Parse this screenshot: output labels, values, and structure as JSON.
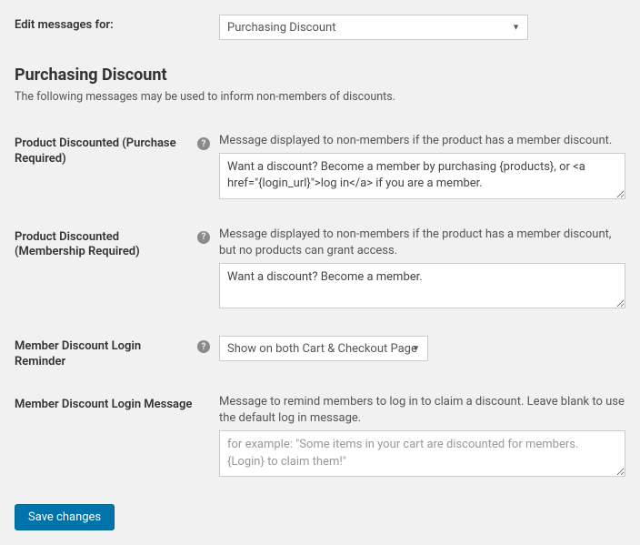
{
  "top": {
    "label": "Edit messages for:",
    "selected": "Purchasing Discount"
  },
  "section": {
    "heading": "Purchasing Discount",
    "sub": "The following messages may be used to inform non-members of discounts."
  },
  "fields": {
    "product_discounted_purchase": {
      "label": "Product Discounted (Purchase Required)",
      "desc": "Message displayed to non-members if the product has a member discount.",
      "value": "Want a discount? Become a member by purchasing {products}, or <a href=\"{login_url}\">log in</a> if you are a member."
    },
    "product_discounted_membership": {
      "label": "Product Discounted (Membership Required)",
      "desc": "Message displayed to non-members if the product has a member discount, but no products can grant access.",
      "value": "Want a discount? Become a member."
    },
    "login_reminder": {
      "label": "Member Discount Login Reminder",
      "selected": "Show on both Cart & Checkout Page"
    },
    "login_message": {
      "label": "Member Discount Login Message",
      "desc": "Message to remind members to log in to claim a discount. Leave blank to use the default log in message.",
      "placeholder": "for example: \"Some items in your cart are discounted for members. {Login} to claim them!\""
    }
  },
  "save_label": "Save changes"
}
